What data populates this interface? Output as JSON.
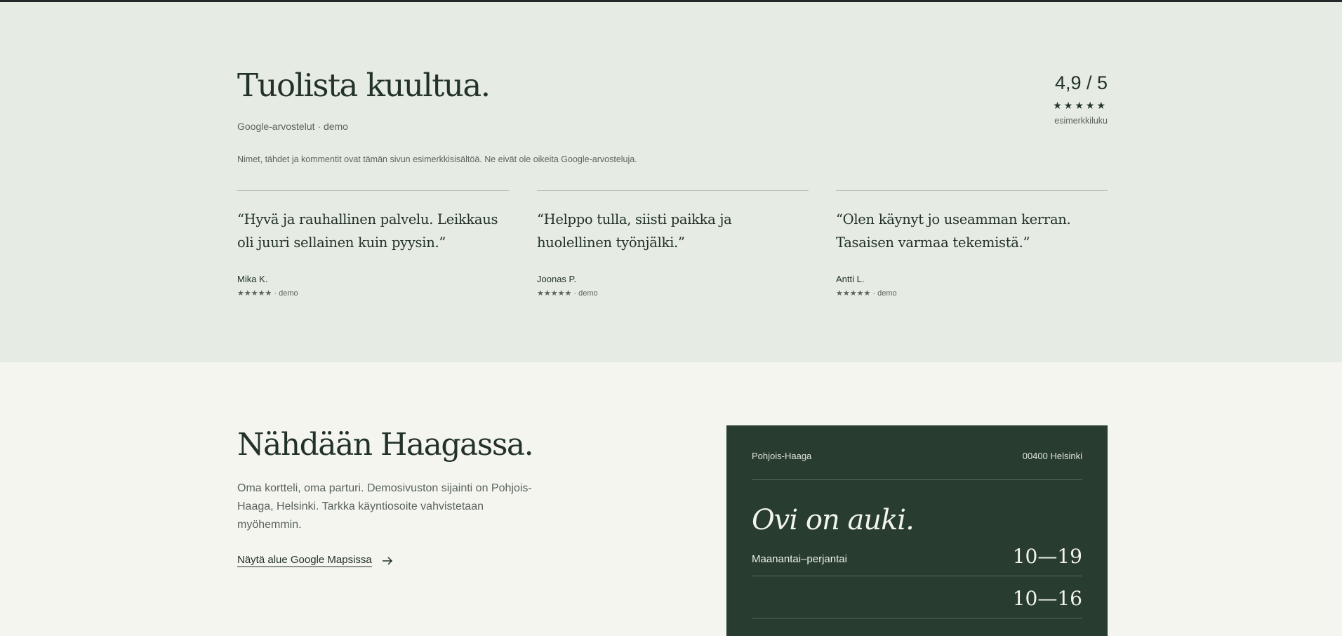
{
  "reviews": {
    "title": "Tuolista kuultua.",
    "subtitle": "Google-arvostelut · demo",
    "disclaimer": "Nimet, tähdet ja kommentit ovat tämän sivun esimerkkisisältöä. Ne eivät ole oikeita Google-arvosteluja.",
    "rating": {
      "score": "4,9 / 5",
      "stars": "★★★★★",
      "note": "esimerkkiluku"
    },
    "items": [
      {
        "quote": "“Hyvä ja rauhallinen palvelu. Leikkaus oli juuri sellainen kuin pyysin.”",
        "name": "Mika K.",
        "meta": "★★★★★ · demo"
      },
      {
        "quote": "“Helppo tulla, siisti paikka ja huolellinen työnjälki.”",
        "name": "Joonas P.",
        "meta": "★★★★★ · demo"
      },
      {
        "quote": "“Olen käynyt jo useamman kerran. Tasaisen varmaa tekemistä.”",
        "name": "Antti L.",
        "meta": "★★★★★ · demo"
      }
    ]
  },
  "visit": {
    "title": "Nähdään Haagassa.",
    "intro": "Oma kortteli, oma parturi. Demosivuston sijainti on Pohjois-Haaga, Helsinki. Tarkka käyntiosoite vahvistetaan myöhemmin.",
    "map_link": "Näytä alue Google Mapsissa",
    "card": {
      "location": "Pohjois-Haaga",
      "postal": "00400 Helsinki",
      "headline": "Ovi on auki.",
      "hours": [
        {
          "day": "Maanantai–perjantai",
          "time": "10—19"
        },
        {
          "day": "",
          "time": "10—16"
        }
      ]
    }
  },
  "colors": {
    "reviews_bg": "#e6ece3",
    "page_bg": "#f4f5ef",
    "card_bg": "#283c2f",
    "text": "#233229",
    "muted": "#5b645d"
  }
}
